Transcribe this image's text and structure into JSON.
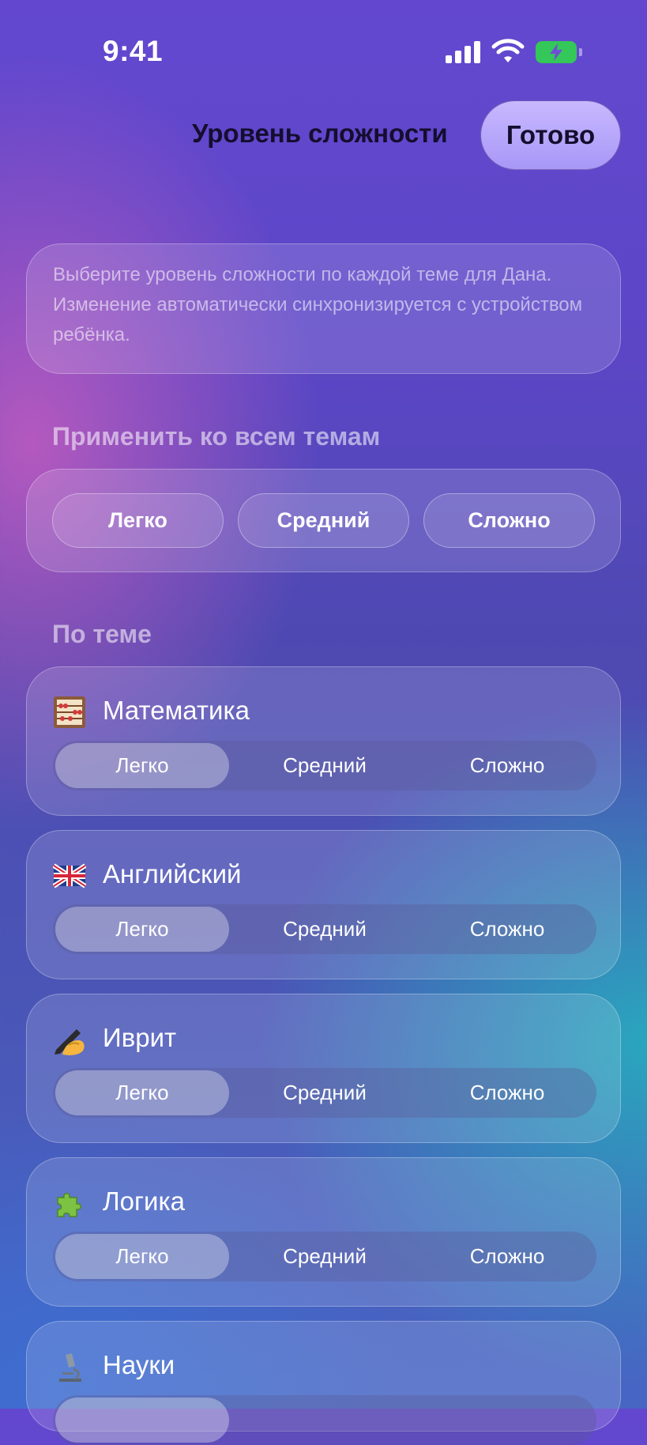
{
  "status_bar": {
    "time": "9:41"
  },
  "header": {
    "title": "Уровень сложности",
    "done_label": "Готово"
  },
  "info": {
    "text": "Выберите уровень сложности по каждой теме для Дана. Изменение автоматически синхронизируется с устройством ребёнка."
  },
  "apply_all": {
    "title": "Применить ко всем темам",
    "buttons": [
      "Легко",
      "Средний",
      "Сложно"
    ]
  },
  "by_topic": {
    "title": "По теме",
    "topics": [
      {
        "icon": "abacus-icon",
        "name": "Математика",
        "options": [
          "Легко",
          "Средний",
          "Сложно"
        ],
        "selected": "Легко"
      },
      {
        "icon": "uk-flag-icon",
        "name": "Английский",
        "options": [
          "Легко",
          "Средний",
          "Сложно"
        ],
        "selected": "Легко"
      },
      {
        "icon": "writing-hand-icon",
        "name": "Иврит",
        "options": [
          "Легко",
          "Средний",
          "Сложно"
        ],
        "selected": "Легко"
      },
      {
        "icon": "puzzle-icon",
        "name": "Логика",
        "options": [
          "Легко",
          "Средний",
          "Сложно"
        ],
        "selected": "Легко"
      },
      {
        "icon": "microscope-icon",
        "name": "Науки",
        "options": [],
        "selected": ""
      }
    ]
  }
}
